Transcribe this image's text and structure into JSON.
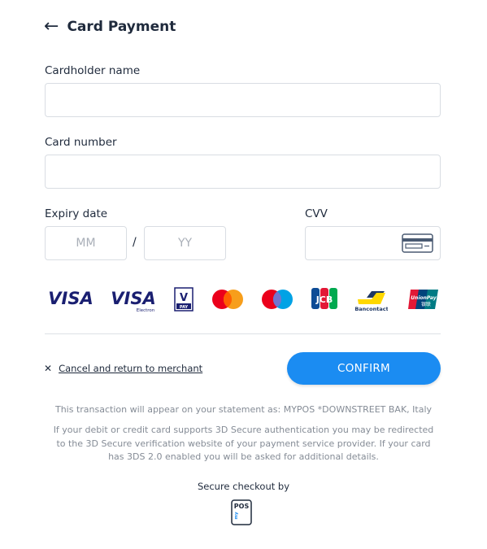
{
  "header": {
    "title": "Card Payment",
    "back_icon": "arrow-left-icon"
  },
  "form": {
    "cardholder_label": "Cardholder name",
    "cardholder_value": "",
    "card_number_label": "Card number",
    "card_number_value": "",
    "expiry_label": "Expiry date",
    "expiry_month_placeholder": "MM",
    "expiry_year_placeholder": "YY",
    "expiry_separator": "/",
    "cvv_label": "CVV",
    "cvv_icon": "card-back-icon"
  },
  "payment_logos": [
    {
      "name": "visa",
      "text": "VISA"
    },
    {
      "name": "visa-electron",
      "text": "VISA",
      "sub": "Electron"
    },
    {
      "name": "vpay",
      "text": "V",
      "sub": "PAY"
    },
    {
      "name": "mastercard"
    },
    {
      "name": "maestro"
    },
    {
      "name": "jcb",
      "text": "JCB"
    },
    {
      "name": "bancontact",
      "sub": "Bancontact"
    },
    {
      "name": "unionpay",
      "text": "UnionPay",
      "sub": "银联"
    }
  ],
  "actions": {
    "cancel_label": "Cancel and return to merchant",
    "confirm_label": "CONFIRM"
  },
  "notes": {
    "statement": "This transaction will appear on your statement as: MYPOS  *DOWNSTREET BAK, Italy",
    "secure_line1": "If your debit or credit card supports 3D Secure authentication you may be redirected",
    "secure_line2": "to the 3D Secure verification website of your payment service provider. If your card",
    "secure_line3": "has 3DS 2.0 enabled you will be asked for additional details."
  },
  "footer": {
    "secure_checkout": "Secure checkout by",
    "logo_text": "POS",
    "logo_sub": "my"
  },
  "colors": {
    "accent": "#1b8cf2",
    "text": "#1f2a3c",
    "muted": "#858c96",
    "visa": "#1a1f71"
  }
}
